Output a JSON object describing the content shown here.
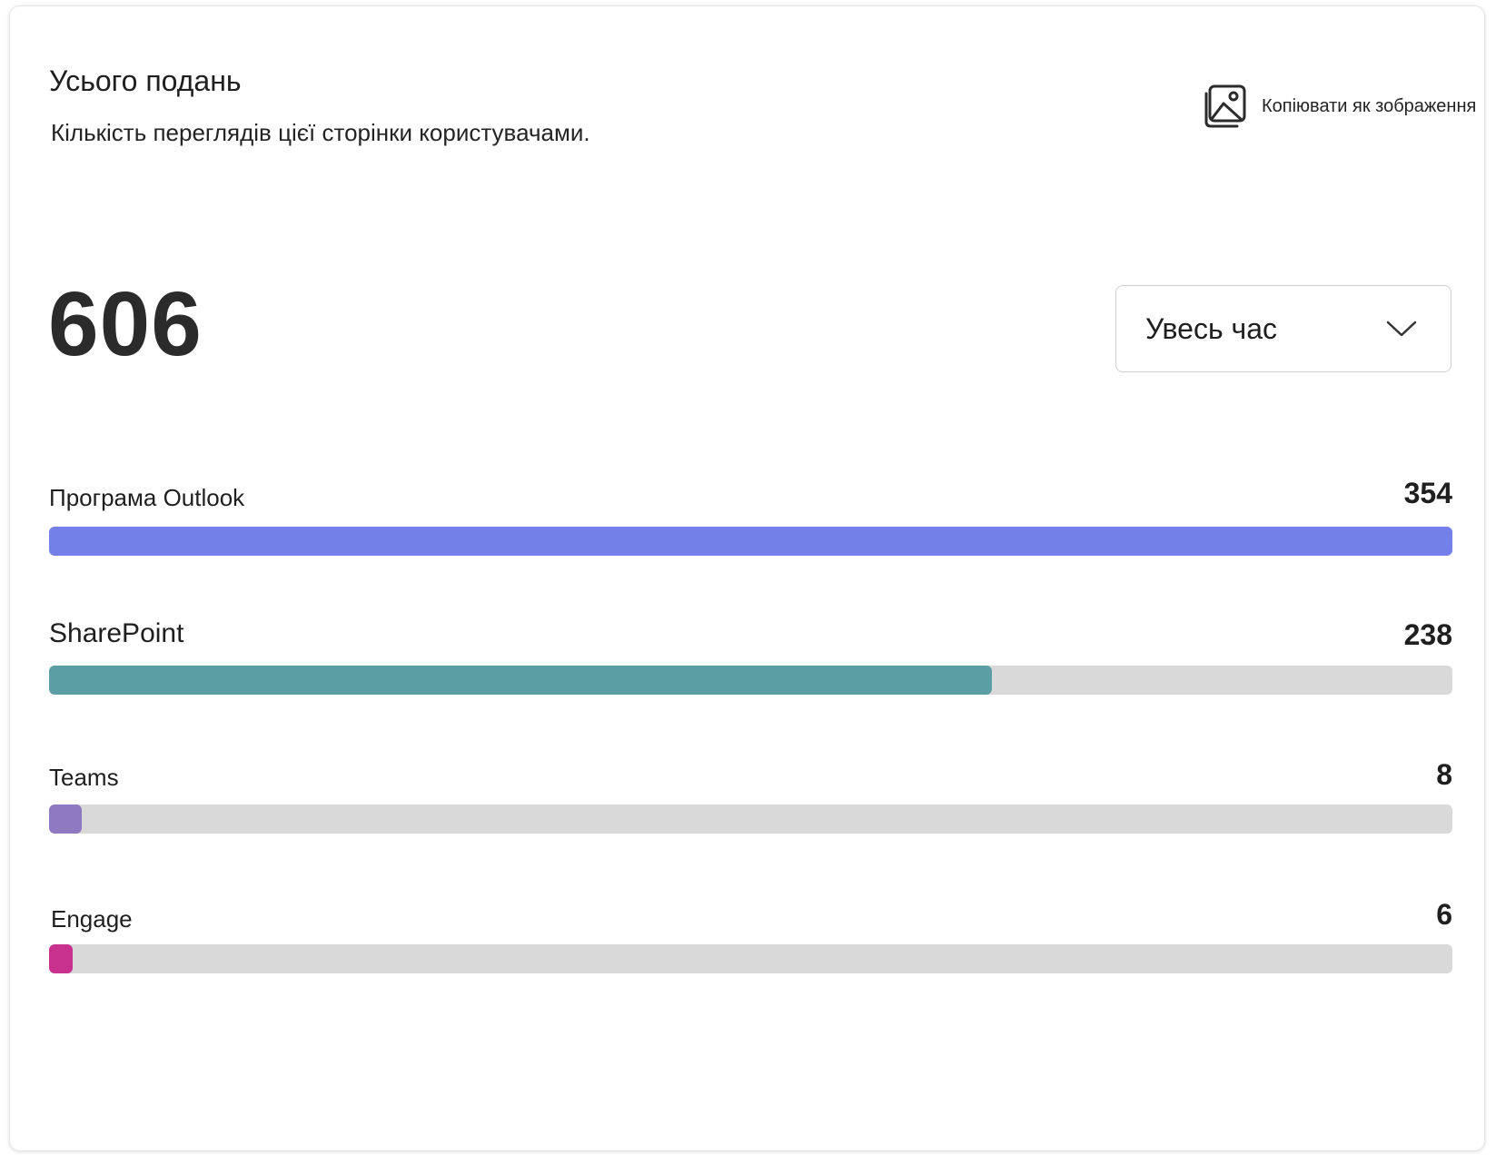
{
  "header": {
    "title": "Усього подань",
    "subtitle": "Кількість переглядів цієї сторінки користувачами.",
    "copy_label": "Копіювати як зображення",
    "copy_icon": "image-copy-icon"
  },
  "summary": {
    "total": "606"
  },
  "period_select": {
    "selected": "Увесь час",
    "icon": "chevron-down-icon"
  },
  "breakdown": [
    {
      "label": "Програма Outlook",
      "count": "354",
      "value": 354,
      "fraction": 1.0,
      "color": "#7280e8"
    },
    {
      "label": "SharePoint",
      "count": "238",
      "value": 238,
      "fraction": 0.672,
      "color": "#5b9ea3"
    },
    {
      "label": "Teams",
      "count": "8",
      "value": 8,
      "fraction": 0.023,
      "color": "#8f79c1"
    },
    {
      "label": "Engage",
      "count": "6",
      "value": 6,
      "fraction": 0.017,
      "color": "#c8318d"
    }
  ],
  "colors": {
    "track": "#d9d9d9"
  }
}
